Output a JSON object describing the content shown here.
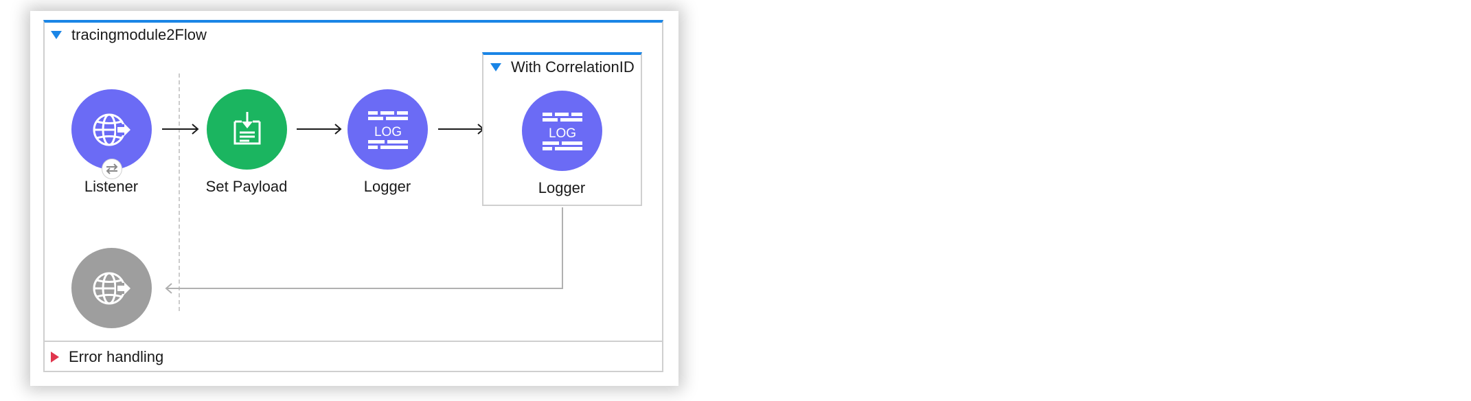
{
  "flow": {
    "title": "tracingmodule2Flow"
  },
  "nodes": {
    "listener": {
      "label": "Listener",
      "icon": "http-listener-icon",
      "color": "#6b6bf5"
    },
    "set_payload": {
      "label": "Set Payload",
      "icon": "set-payload-icon",
      "color": "#1bb560"
    },
    "logger1": {
      "label": "Logger",
      "icon": "logger-icon",
      "color": "#6b6bf5",
      "icon_text": "LOG"
    },
    "logger2": {
      "label": "Logger",
      "icon": "logger-icon",
      "color": "#6b6bf5",
      "icon_text": "LOG"
    },
    "response": {
      "icon": "http-response-icon",
      "color": "#9e9e9e"
    }
  },
  "scope": {
    "title": "With CorrelationID"
  },
  "error_handling": {
    "label": "Error handling"
  },
  "colors": {
    "accent": "#1a85e6",
    "error": "#e0364d"
  }
}
